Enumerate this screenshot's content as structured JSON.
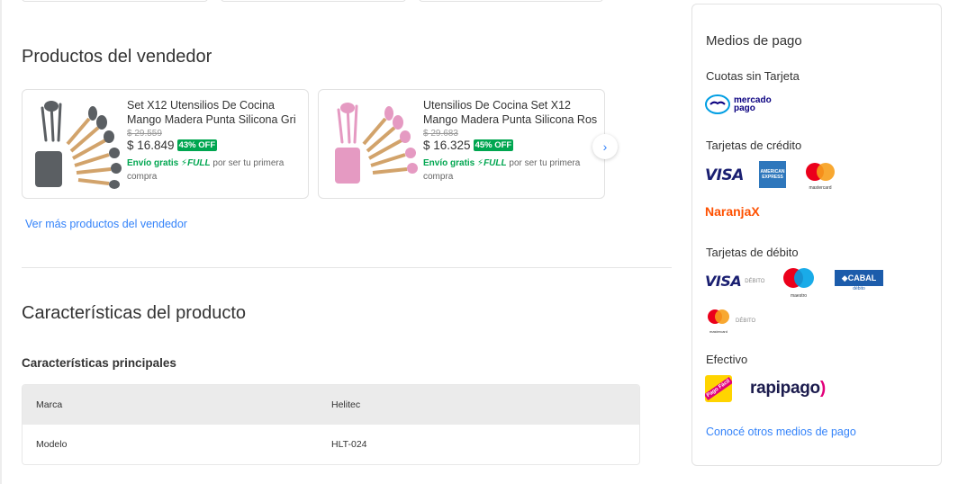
{
  "seller_section": {
    "title": "Productos del vendedor",
    "products": [
      {
        "title_line1": "Set X12 Utensilios De Cocina",
        "title_line2": "Mango Madera Punta Silicona Gri",
        "old_price": "$ 29.559",
        "price": "$ 16.849",
        "discount": "43% OFF",
        "shipping_free": "Envío gratis",
        "shipping_full": "FULL",
        "shipping_rest": "por ser tu primera compra",
        "color": "#5b5f63"
      },
      {
        "title_line1": "Utensilios De Cocina Set X12",
        "title_line2": "Mango Madera Punta Silicona Ros",
        "old_price": "$ 29.683",
        "price": "$ 16.325",
        "discount": "45% OFF",
        "shipping_free": "Envío gratis",
        "shipping_full": "FULL",
        "shipping_rest": "por ser tu primera compra",
        "color": "#e59ac2"
      }
    ],
    "more_link": "Ver más productos del vendedor"
  },
  "characteristics": {
    "title": "Características del producto",
    "subtitle": "Características principales",
    "rows": [
      {
        "key": "Marca",
        "value": "Helitec"
      },
      {
        "key": "Modelo",
        "value": "HLT-024"
      }
    ]
  },
  "payment": {
    "title": "Medios de pago",
    "groups": {
      "cuotas": "Cuotas sin Tarjeta",
      "credito": "Tarjetas de crédito",
      "debito": "Tarjetas de débito",
      "efectivo": "Efectivo"
    },
    "logos": {
      "mercadopago_line1": "mercado",
      "mercadopago_line2": "pago",
      "visa": "VISA",
      "amex": "AMERICAN EXPRESS",
      "mastercard": "mastercard",
      "naranja": "NaranjaX",
      "debito_tag": "DÉBITO",
      "maestro": "maestro",
      "cabal": "CABAL",
      "cabal_debito": "débito",
      "pagofacil": "Pago Fácil",
      "rapipago": "rapipago"
    },
    "more_link": "Conocé otros medios de pago"
  },
  "colors": {
    "accent_blue": "#3483fa",
    "green": "#00a650"
  }
}
